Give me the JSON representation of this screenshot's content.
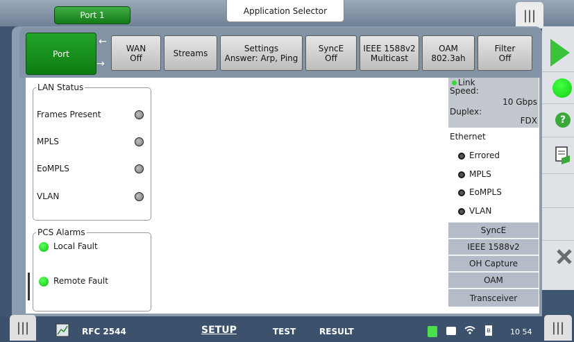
{
  "header": {
    "port_tab": "Port 1",
    "app_selector": "Application Selector",
    "menu_glyph": "|||"
  },
  "tabs": {
    "port": "Port",
    "wan": [
      "WAN",
      "Off"
    ],
    "streams": "Streams",
    "settings": [
      "Settings",
      "Answer: Arp, Ping"
    ],
    "synce": [
      "SyncE",
      "Off"
    ],
    "ieee": [
      "IEEE 1588v2",
      "Multicast"
    ],
    "oam": [
      "OAM",
      "802.3ah"
    ],
    "filter": [
      "Filter",
      "Off"
    ]
  },
  "lan_status": {
    "title": "LAN Status",
    "rows": [
      "Frames Present",
      "MPLS",
      "EoMPLS",
      "VLAN"
    ]
  },
  "pcs_alarms": {
    "title": "PCS Alarms",
    "rows": [
      "Local Fault",
      "Remote Fault"
    ]
  },
  "status": {
    "link": "Link",
    "speed_label": "Speed:",
    "speed_value": "10 Gbps",
    "duplex_label": "Duplex:",
    "duplex_value": "FDX"
  },
  "ethernet": {
    "title": "Ethernet",
    "items": [
      "Errored",
      "MPLS",
      "EoMPLS",
      "VLAN"
    ]
  },
  "side_buttons": [
    "SyncE",
    "IEEE 1588v2",
    "OH Capture",
    "OAM",
    "Transceiver"
  ],
  "bottom": {
    "test_name": "RFC 2544",
    "setup": "SETUP",
    "test": "TEST",
    "result": "RESULT",
    "time": "10 54"
  },
  "colors": {
    "active_green": "#1a9620",
    "indicator_green": "#18d018",
    "frame": "#8b9cae"
  }
}
